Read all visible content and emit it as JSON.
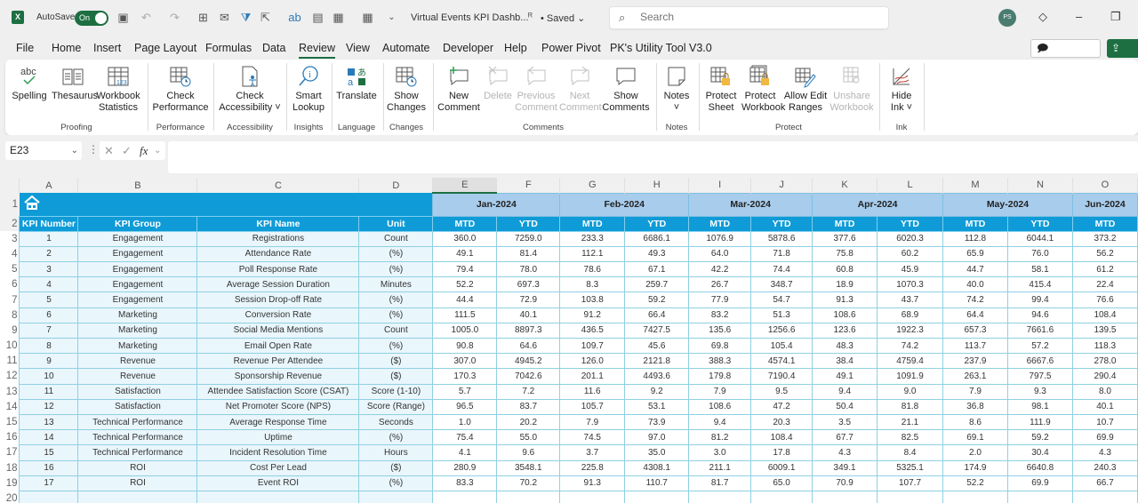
{
  "titlebar": {
    "app_logo": "X",
    "autosave_label": "AutoSave",
    "autosave_state": "On",
    "doc_title": "Virtual Events KPI Dashb...",
    "saved_status": "• Saved",
    "search_placeholder": "Search",
    "avatar_initials": "PS"
  },
  "menu": {
    "tabs": [
      "File",
      "Home",
      "Insert",
      "Page Layout",
      "Formulas",
      "Data",
      "Review",
      "View",
      "Automate",
      "Developer",
      "Help",
      "Power Pivot",
      "PK's Utility Tool V3.0"
    ],
    "active_tab": "Review",
    "comments_button": "Comments",
    "share_button": "Share"
  },
  "ribbon": {
    "buttons": {
      "spelling": "Spelling",
      "thesaurus": "Thesaurus",
      "workbook_statistics_1": "Workbook",
      "workbook_statistics_2": "Statistics",
      "check_performance_1": "Check",
      "check_performance_2": "Performance",
      "check_accessibility_1": "Check",
      "check_accessibility_2": "Accessibility ˅",
      "smart_lookup_1": "Smart",
      "smart_lookup_2": "Lookup",
      "translate": "Translate",
      "show_changes_1": "Show",
      "show_changes_2": "Changes",
      "new_comment_1": "New",
      "new_comment_2": "Comment",
      "delete": "Delete",
      "previous_comment_1": "Previous",
      "previous_comment_2": "Comment",
      "next_comment_1": "Next",
      "next_comment_2": "Comment",
      "show_comments_1": "Show",
      "show_comments_2": "Comments",
      "notes_1": "Notes",
      "notes_2": "˅",
      "protect_sheet_1": "Protect",
      "protect_sheet_2": "Sheet",
      "protect_workbook_1": "Protect",
      "protect_workbook_2": "Workbook",
      "allow_edit_ranges_1": "Allow Edit",
      "allow_edit_ranges_2": "Ranges",
      "unshare_workbook_1": "Unshare",
      "unshare_workbook_2": "Workbook",
      "hide_ink_1": "Hide",
      "hide_ink_2": "Ink ˅"
    },
    "groups": {
      "proofing": "Proofing",
      "performance": "Performance",
      "accessibility": "Accessibility",
      "insights": "Insights",
      "language": "Language",
      "changes": "Changes",
      "comments": "Comments",
      "notes": "Notes",
      "protect": "Protect",
      "ink": "Ink"
    }
  },
  "formula_bar": {
    "name_box": "E23",
    "fx_label": "fx",
    "formula": ""
  },
  "sheet": {
    "column_letters": [
      "A",
      "B",
      "C",
      "D",
      "E",
      "F",
      "G",
      "H",
      "I",
      "J",
      "K",
      "L",
      "M",
      "N",
      "O"
    ],
    "selected_column": "E",
    "row_numbers": [
      "1",
      "2",
      "3",
      "4",
      "5",
      "6",
      "7",
      "8",
      "9",
      "10",
      "11",
      "12",
      "13",
      "14",
      "15",
      "16",
      "17",
      "18",
      "19",
      "20"
    ],
    "months": [
      "Jan-2024",
      "Feb-2024",
      "Mar-2024",
      "Apr-2024",
      "May-2024",
      "Jun-2024"
    ],
    "headers": [
      "KPI Number",
      "KPI Group",
      "KPI Name",
      "Unit",
      "MTD",
      "YTD",
      "MTD",
      "YTD",
      "MTD",
      "YTD",
      "MTD",
      "YTD",
      "MTD",
      "YTD",
      "MTD"
    ],
    "rows": [
      [
        "1",
        "Engagement",
        "Registrations",
        "Count",
        "360.0",
        "7259.0",
        "233.3",
        "6686.1",
        "1076.9",
        "5878.6",
        "377.6",
        "6020.3",
        "112.8",
        "6044.1",
        "373.2"
      ],
      [
        "2",
        "Engagement",
        "Attendance Rate",
        "(%)",
        "49.1",
        "81.4",
        "112.1",
        "49.3",
        "64.0",
        "71.8",
        "75.8",
        "60.2",
        "65.9",
        "76.0",
        "56.2"
      ],
      [
        "3",
        "Engagement",
        "Poll Response Rate",
        "(%)",
        "79.4",
        "78.0",
        "78.6",
        "67.1",
        "42.2",
        "74.4",
        "60.8",
        "45.9",
        "44.7",
        "58.1",
        "61.2"
      ],
      [
        "4",
        "Engagement",
        "Average Session Duration",
        "Minutes",
        "52.2",
        "697.3",
        "8.3",
        "259.7",
        "26.7",
        "348.7",
        "18.9",
        "1070.3",
        "40.0",
        "415.4",
        "22.4"
      ],
      [
        "5",
        "Engagement",
        "Session Drop-off Rate",
        "(%)",
        "44.4",
        "72.9",
        "103.8",
        "59.2",
        "77.9",
        "54.7",
        "91.3",
        "43.7",
        "74.2",
        "99.4",
        "76.6"
      ],
      [
        "6",
        "Marketing",
        "Conversion Rate",
        "(%)",
        "111.5",
        "40.1",
        "91.2",
        "66.4",
        "83.2",
        "51.3",
        "108.6",
        "68.9",
        "64.4",
        "94.6",
        "108.4"
      ],
      [
        "7",
        "Marketing",
        "Social Media Mentions",
        "Count",
        "1005.0",
        "8897.3",
        "436.5",
        "7427.5",
        "135.6",
        "1256.6",
        "123.6",
        "1922.3",
        "657.3",
        "7661.6",
        "139.5"
      ],
      [
        "8",
        "Marketing",
        "Email Open Rate",
        "(%)",
        "90.8",
        "64.6",
        "109.7",
        "45.6",
        "69.8",
        "105.4",
        "48.3",
        "74.2",
        "113.7",
        "57.2",
        "118.3"
      ],
      [
        "9",
        "Revenue",
        "Revenue Per Attendee",
        "($)",
        "307.0",
        "4945.2",
        "126.0",
        "2121.8",
        "388.3",
        "4574.1",
        "38.4",
        "4759.4",
        "237.9",
        "6667.6",
        "278.0"
      ],
      [
        "10",
        "Revenue",
        "Sponsorship Revenue",
        "($)",
        "170.3",
        "7042.6",
        "201.1",
        "4493.6",
        "179.8",
        "7190.4",
        "49.1",
        "1091.9",
        "263.1",
        "797.5",
        "290.4"
      ],
      [
        "11",
        "Satisfaction",
        "Attendee Satisfaction Score (CSAT)",
        "Score (1-10)",
        "5.7",
        "7.2",
        "11.6",
        "9.2",
        "7.9",
        "9.5",
        "9.4",
        "9.0",
        "7.9",
        "9.3",
        "8.0"
      ],
      [
        "12",
        "Satisfaction",
        "Net Promoter Score (NPS)",
        "Score (Range)",
        "96.5",
        "83.7",
        "105.7",
        "53.1",
        "108.6",
        "47.2",
        "50.4",
        "81.8",
        "36.8",
        "98.1",
        "40.1"
      ],
      [
        "13",
        "Technical Performance",
        "Average Response Time",
        "Seconds",
        "1.0",
        "20.2",
        "7.9",
        "73.9",
        "9.4",
        "20.3",
        "3.5",
        "21.1",
        "8.6",
        "111.9",
        "10.7"
      ],
      [
        "14",
        "Technical Performance",
        "Uptime",
        "(%)",
        "75.4",
        "55.0",
        "74.5",
        "97.0",
        "81.2",
        "108.4",
        "67.7",
        "82.5",
        "69.1",
        "59.2",
        "69.9"
      ],
      [
        "15",
        "Technical Performance",
        "Incident Resolution Time",
        "Hours",
        "4.1",
        "9.6",
        "3.7",
        "35.0",
        "3.0",
        "17.8",
        "4.3",
        "8.4",
        "2.0",
        "30.4",
        "4.3"
      ],
      [
        "16",
        "ROI",
        "Cost Per Lead",
        "($)",
        "280.9",
        "3548.1",
        "225.8",
        "4308.1",
        "211.1",
        "6009.1",
        "349.1",
        "5325.1",
        "174.9",
        "6640.8",
        "240.3"
      ],
      [
        "17",
        "ROI",
        "Event ROI",
        "(%)",
        "83.3",
        "70.2",
        "91.3",
        "110.7",
        "81.7",
        "65.0",
        "70.9",
        "107.7",
        "52.2",
        "69.9",
        "66.7"
      ]
    ]
  },
  "colors": {
    "excel_green": "#1d6f42",
    "header_blue": "#0f9bd7",
    "month_band": "#a8ccec",
    "label_fill": "#e9f6fc",
    "grid_line": "#8fd0e3"
  }
}
